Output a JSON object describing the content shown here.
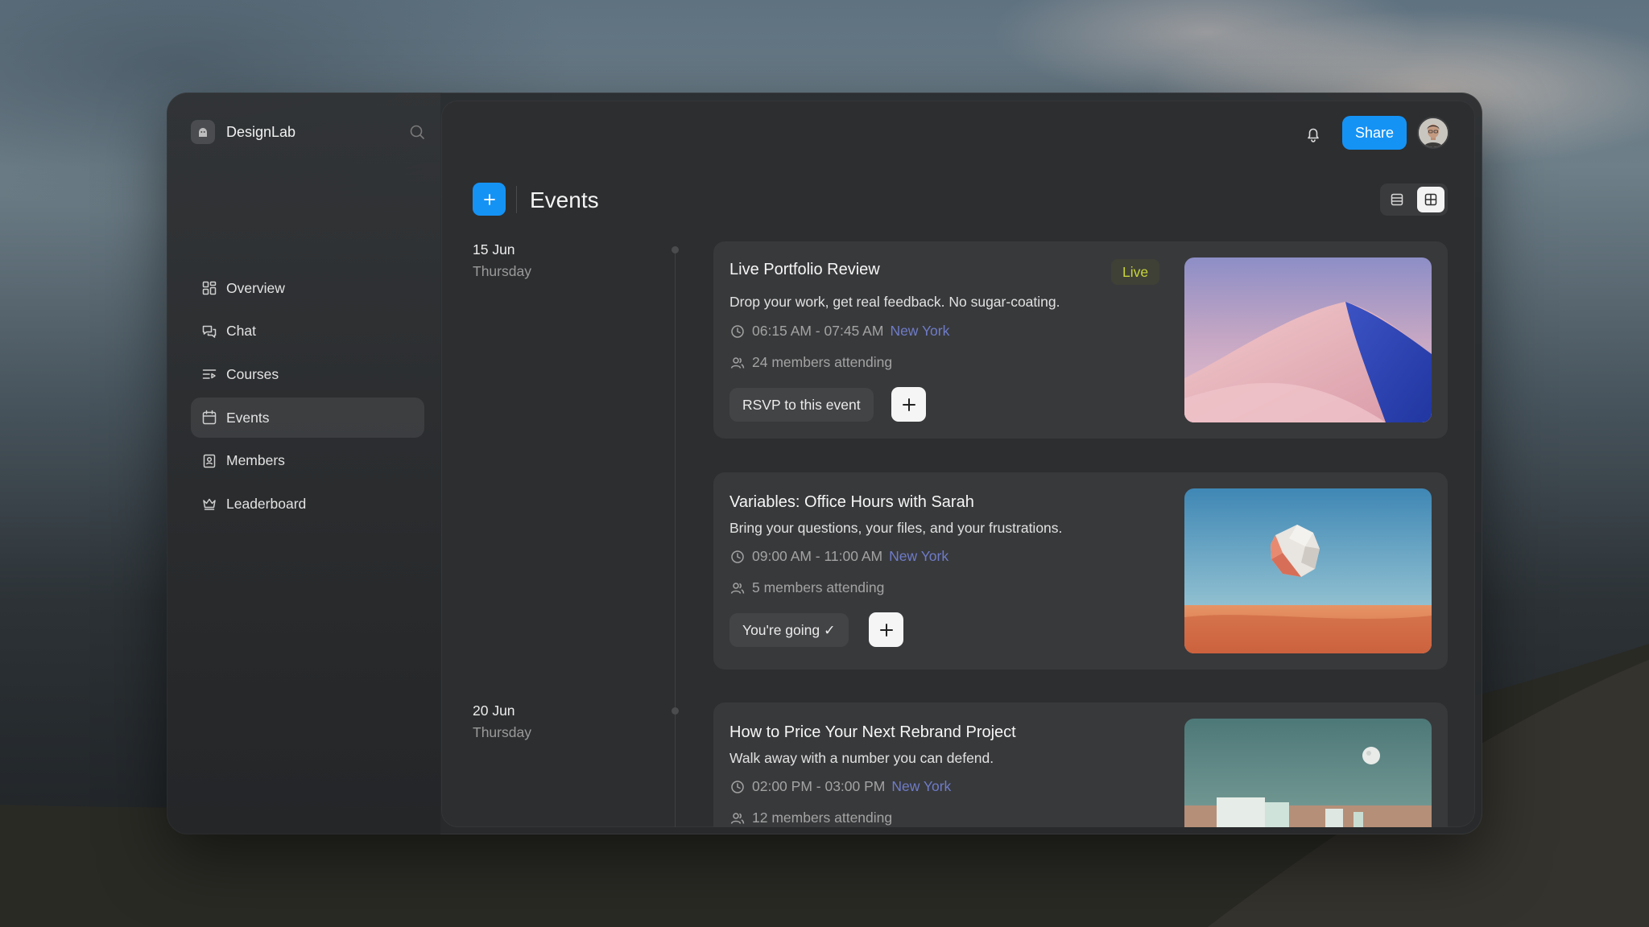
{
  "app": {
    "name": "DesignLab"
  },
  "sidebar": {
    "items": [
      {
        "label": "Overview",
        "icon": "grid-icon"
      },
      {
        "label": "Chat",
        "icon": "chat-icon"
      },
      {
        "label": "Courses",
        "icon": "courses-icon"
      },
      {
        "label": "Events",
        "icon": "calendar-icon",
        "active": true
      },
      {
        "label": "Members",
        "icon": "member-icon"
      },
      {
        "label": "Leaderboard",
        "icon": "crown-icon"
      }
    ]
  },
  "header": {
    "share_label": "Share"
  },
  "page": {
    "title": "Events"
  },
  "dates": [
    {
      "day": "15 Jun",
      "weekday": "Thursday"
    },
    {
      "day": "20 Jun",
      "weekday": "Thursday"
    }
  ],
  "events": [
    {
      "title": "Live Portfolio Review",
      "badge": "Live",
      "description": "Drop your work, get real feedback. No sugar-coating.",
      "time": "06:15 AM - 07:45 AM",
      "location": "New York",
      "attendees": "24 members attending",
      "action_label": "RSVP to this event"
    },
    {
      "title": "Variables: Office Hours with Sarah",
      "description": "Bring your questions, your files, and your frustrations.",
      "time": "09:00 AM - 11:00 AM",
      "location": "New York",
      "attendees": "5 members attending",
      "action_label": "You're going ✓"
    },
    {
      "title": "How to Price Your Next Rebrand Project",
      "description": "Walk away with a number you can defend.",
      "time": "02:00 PM - 03:00 PM",
      "location": "New York",
      "attendees": "12 members attending"
    }
  ],
  "colors": {
    "accent": "#1593f5",
    "live": "#c7d53b",
    "location": "#6f7cc8"
  }
}
